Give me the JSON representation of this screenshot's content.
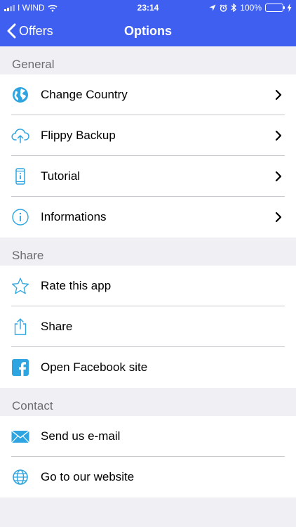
{
  "status_bar": {
    "carrier": "I WIND",
    "time": "23:14",
    "battery_percent": "100%",
    "signal_bars_filled": 2,
    "battery_level": 1.0
  },
  "nav": {
    "back_label": "Offers",
    "title": "Options"
  },
  "sections": {
    "general": "General",
    "share": "Share",
    "contact": "Contact"
  },
  "items": {
    "change_country": "Change Country",
    "flippy_backup": "Flippy Backup",
    "tutorial": "Tutorial",
    "informations": "Informations",
    "rate_app": "Rate this app",
    "share": "Share",
    "facebook": "Open Facebook site",
    "email": "Send us e-mail",
    "website": "Go to our website"
  },
  "colors": {
    "accent": "#3f5ff0",
    "icon": "#2ea5e0",
    "battery": "#4cd964",
    "background": "#efeff4"
  }
}
